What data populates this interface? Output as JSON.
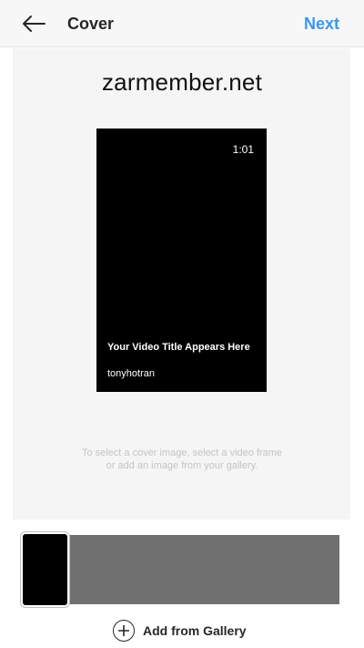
{
  "header": {
    "back_icon": "arrow-left-icon",
    "title": "Cover",
    "next_label": "Next"
  },
  "watermark": "zarmember.net",
  "preview": {
    "duration": "1:01",
    "video_title": "Your Video Title Appears Here",
    "username": "tonyhotran"
  },
  "hint_text": "To select a cover image, select a video frame or add an image from your gallery.",
  "gallery": {
    "icon": "plus-circle-icon",
    "label": "Add from Gallery"
  },
  "colors": {
    "accent": "#3897f0",
    "strip": "#707070",
    "preview_bg": "#000000"
  }
}
